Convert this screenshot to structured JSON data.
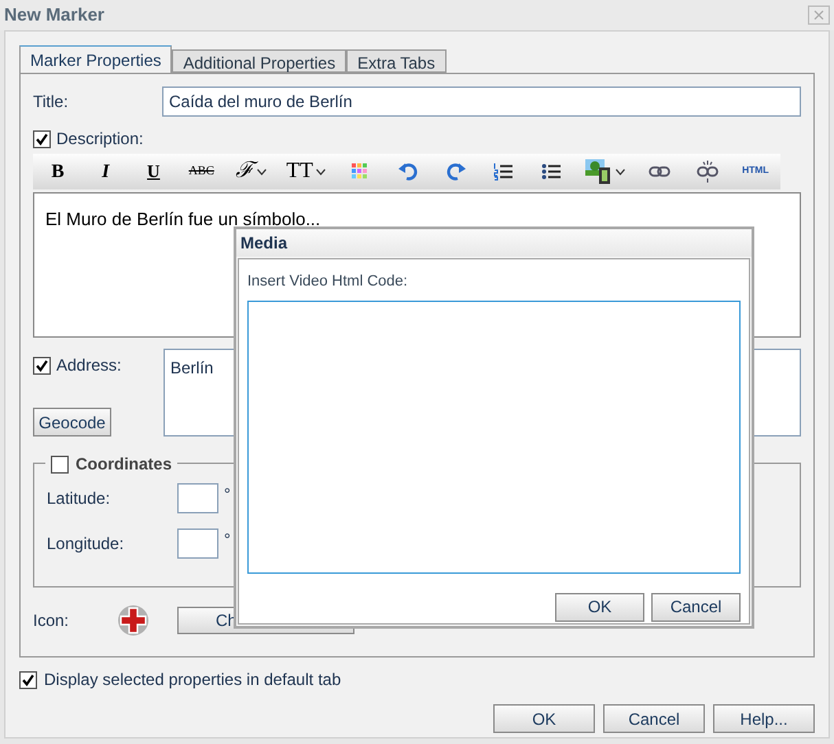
{
  "window": {
    "title": "New Marker"
  },
  "tabs": [
    {
      "label": "Marker Properties",
      "selected": true
    },
    {
      "label": "Additional Properties",
      "selected": false
    },
    {
      "label": "Extra Tabs",
      "selected": false
    }
  ],
  "title_field": {
    "label": "Title:",
    "value": "Caída del muro de Berlín"
  },
  "description": {
    "label": "Description:",
    "checked": true,
    "toolbar": [
      {
        "kind": "bold",
        "label": "B"
      },
      {
        "kind": "italic",
        "label": "I"
      },
      {
        "kind": "underline",
        "label": "U"
      },
      {
        "kind": "strike",
        "label": "ABC"
      },
      {
        "kind": "font",
        "label": "ℱ",
        "dropdown": true
      },
      {
        "kind": "size",
        "label": "TT",
        "dropdown": true
      },
      {
        "kind": "colors"
      },
      {
        "kind": "undo"
      },
      {
        "kind": "redo"
      },
      {
        "kind": "ordered"
      },
      {
        "kind": "bullets"
      },
      {
        "kind": "media",
        "dropdown": true
      },
      {
        "kind": "link"
      },
      {
        "kind": "unlink"
      },
      {
        "kind": "html",
        "label": "HTML"
      }
    ],
    "content": "El Muro de Berlín fue un símbolo..."
  },
  "address": {
    "label": "Address:",
    "checked": true,
    "value": "Berlín",
    "button": "Geocode"
  },
  "coordinates": {
    "label": "Coordinates",
    "checked": false,
    "fields": [
      {
        "label": "Latitude:",
        "unit": "°"
      },
      {
        "label": "Longitude:",
        "unit": "°"
      }
    ]
  },
  "icon_row": {
    "label": "Icon:",
    "button": "Ch"
  },
  "default_tab": {
    "label": "Display selected properties in default tab",
    "checked": true
  },
  "buttons": [
    "OK",
    "Cancel",
    "Help..."
  ],
  "media_dialog": {
    "title": "Media",
    "label": "Insert Video Html Code:",
    "buttons": [
      "OK",
      "Cancel"
    ]
  }
}
